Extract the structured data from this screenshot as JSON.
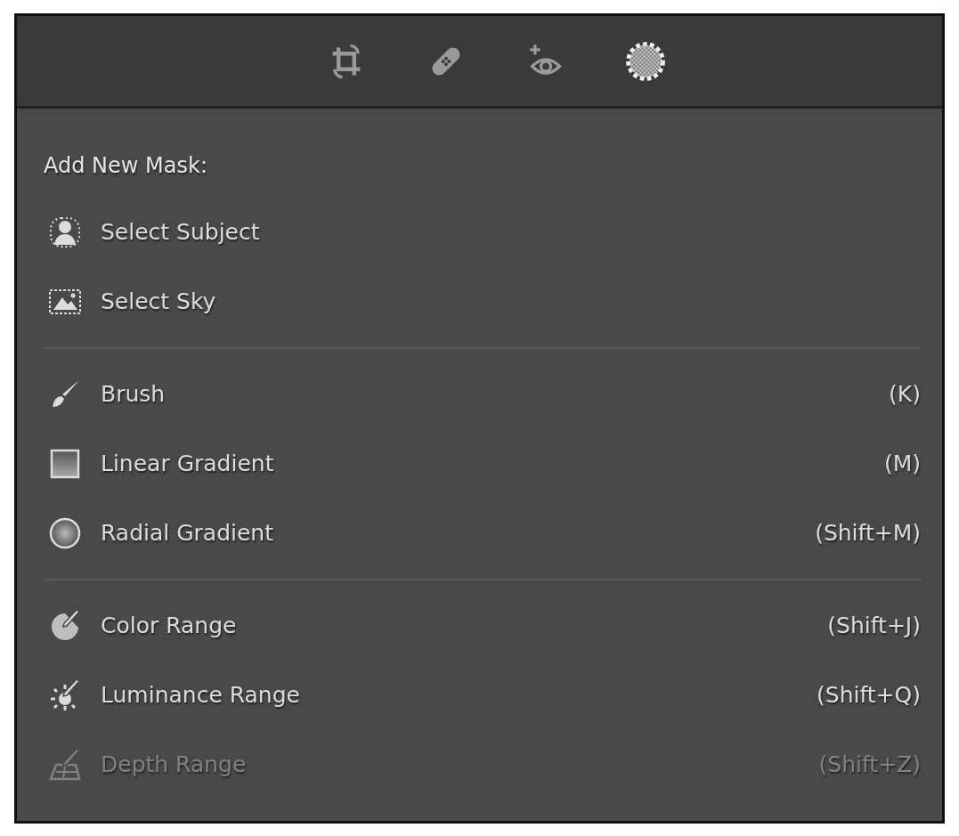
{
  "toolbar": {
    "tools": [
      {
        "kind": "crop",
        "selected": false
      },
      {
        "kind": "heal",
        "selected": false
      },
      {
        "kind": "redeye",
        "selected": false
      },
      {
        "kind": "masking",
        "selected": true
      }
    ]
  },
  "menu": {
    "heading": "Add New Mask:",
    "sections": [
      {
        "items": [
          {
            "kind": "subject",
            "label": "Select Subject",
            "disabled": false
          },
          {
            "kind": "sky",
            "label": "Select Sky",
            "disabled": false
          }
        ]
      },
      {
        "items": [
          {
            "kind": "brush",
            "label": "Brush",
            "shortcut": "(K)",
            "disabled": false
          },
          {
            "kind": "linear",
            "label": "Linear Gradient",
            "shortcut": "(M)",
            "disabled": false
          },
          {
            "kind": "radial",
            "label": "Radial Gradient",
            "shortcut": "(Shift+M)",
            "disabled": false
          }
        ]
      },
      {
        "items": [
          {
            "kind": "color",
            "label": "Color Range",
            "shortcut": "(Shift+J)",
            "disabled": false
          },
          {
            "kind": "luminance",
            "label": "Luminance Range",
            "shortcut": "(Shift+Q)",
            "disabled": false
          },
          {
            "kind": "depth",
            "label": "Depth Range",
            "shortcut": "(Shift+Z)",
            "disabled": true
          }
        ]
      }
    ]
  }
}
